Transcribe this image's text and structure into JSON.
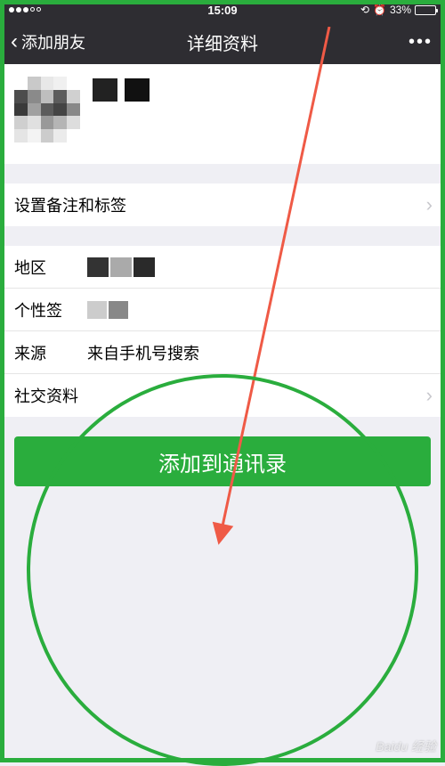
{
  "statusBar": {
    "time": "15:09",
    "batteryPercent": "33%"
  },
  "nav": {
    "back": "添加朋友",
    "title": "详细资料",
    "more": "•••"
  },
  "rows": {
    "tagsLabel": "设置备注和标签",
    "regionLabel": "地区",
    "signatureLabel": "个性签",
    "sourceLabel": "来源",
    "sourceValue": "来自手机号搜索",
    "socialLabel": "社交资料"
  },
  "action": {
    "addButton": "添加到通讯录"
  },
  "watermark": "Baidu 经验"
}
